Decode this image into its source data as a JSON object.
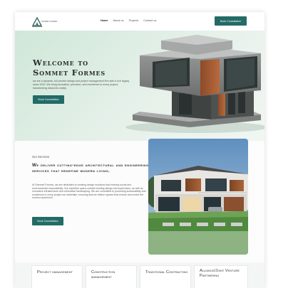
{
  "header": {
    "logo_name": "SOMMET FORMES",
    "nav": [
      "Home",
      "About us",
      "Projects",
      "Contact us"
    ],
    "cta_label": "Book Consultation"
  },
  "hero": {
    "title_line1": "Welcome to",
    "title_line2": "Sommet Formes",
    "description": "we are a dynamic, full-service design and project management firm with a rich legacy since 2010. We bring innovation, precision, and excellence to every project, transforming ideas into reality.",
    "cta_label": "Book Consultation"
  },
  "services": {
    "label": "Our Services",
    "title": "We deliver cutting-edge architectural and engineering services that redefine modern living.",
    "description": "At Sommet Formes, we are dedicated to creating design solutions that embody social and environmental responsibility. Our expertise spans outside building design and supervision, as well as innovative infrastructure and restorative landscaping. We are committed to promoting sustainability and excellence in every project we undertake, ensuring that we deliver spaces that endure and enrich the human experience.",
    "cta_label": "Book Consultation"
  },
  "service_cards": [
    {
      "title": "Project management"
    },
    {
      "title": "Construction management"
    },
    {
      "title": "Traditional Contracting"
    },
    {
      "title": "Alliance/Joint Venture Partnering"
    }
  ],
  "colors": {
    "accent": "#236b66",
    "hero_bg": "#d8ebe0"
  }
}
